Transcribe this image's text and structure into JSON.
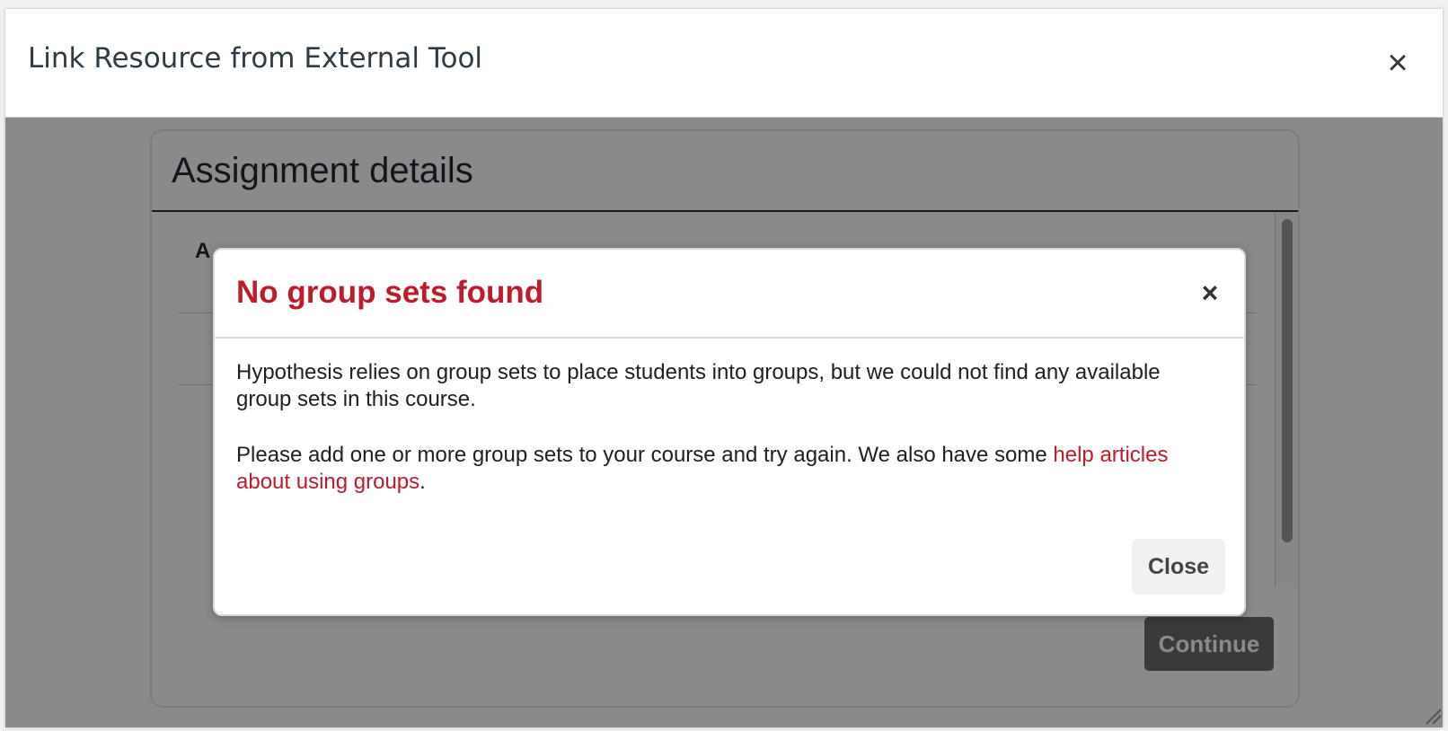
{
  "window": {
    "title": "Link Resource from External Tool",
    "close_glyph": "×",
    "close_icon": "close-icon"
  },
  "assignment": {
    "title": "Assignment details",
    "first_field_label_visible": "A",
    "continue_label": "Continue"
  },
  "modal": {
    "title": "No group sets found",
    "close_glyph": "×",
    "close_icon": "close-icon",
    "paragraph1": "Hypothesis relies on group sets to place students into groups, but we could not find any available group sets in this course.",
    "paragraph2_prefix": "Please add one or more group sets to your course and try again. We also have some ",
    "help_link": "help articles about using groups",
    "paragraph2_suffix": ".",
    "close_button_label": "Close"
  },
  "colors": {
    "accent": "#bd1c2b",
    "overlay": "rgba(0,0,0,0.46)",
    "continue_bg": "#6b6b6b"
  }
}
